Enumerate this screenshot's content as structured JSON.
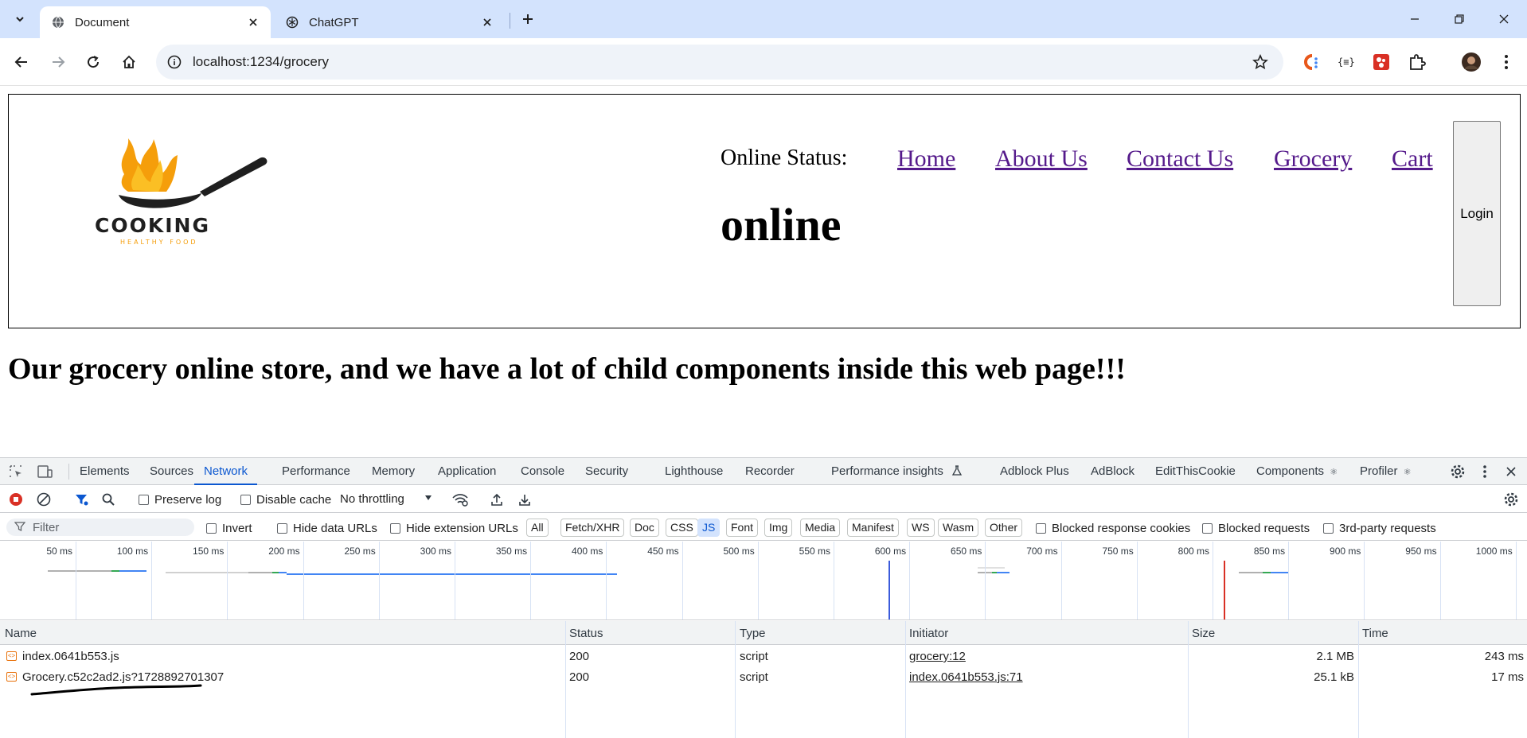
{
  "browser": {
    "tabs": [
      {
        "title": "Document",
        "active": true
      },
      {
        "title": "ChatGPT",
        "active": false
      }
    ],
    "url": "localhost:1234/grocery"
  },
  "page": {
    "online_status_label": "Online Status:",
    "online_status_value": "online",
    "nav": [
      "Home",
      "About Us",
      "Contact Us",
      "Grocery",
      "Cart"
    ],
    "login_label": "Login",
    "logo_text": "COOKING",
    "logo_subtext": "HEALTHY FOOD",
    "heading": "Our grocery online store, and we have a lot of child components inside this web page!!!"
  },
  "devtools": {
    "tabs": [
      "Elements",
      "Sources",
      "Network",
      "Performance",
      "Memory",
      "Application",
      "Console",
      "Security",
      "Lighthouse",
      "Recorder",
      "Performance insights",
      "Adblock Plus",
      "AdBlock",
      "EditThisCookie",
      "Components",
      "Profiler"
    ],
    "active_tab": "Network",
    "controls": {
      "preserve_log": "Preserve log",
      "disable_cache": "Disable cache",
      "throttling": "No throttling"
    },
    "filter": {
      "placeholder": "Filter",
      "invert": "Invert",
      "hide_data_urls": "Hide data URLs",
      "hide_extension_urls": "Hide extension URLs",
      "types": [
        "All",
        "Fetch/XHR",
        "Doc",
        "CSS",
        "JS",
        "Font",
        "Img",
        "Media",
        "Manifest",
        "WS",
        "Wasm",
        "Other"
      ],
      "selected_type": "JS",
      "blocked_response_cookies": "Blocked response cookies",
      "blocked_requests": "Blocked requests",
      "third_party": "3rd-party requests"
    },
    "timeline_ticks": [
      "50 ms",
      "100 ms",
      "150 ms",
      "200 ms",
      "250 ms",
      "300 ms",
      "350 ms",
      "400 ms",
      "450 ms",
      "500 ms",
      "550 ms",
      "600 ms",
      "650 ms",
      "700 ms",
      "750 ms",
      "800 ms",
      "850 ms",
      "900 ms",
      "950 ms",
      "1000 ms"
    ],
    "columns": [
      "Name",
      "Status",
      "Type",
      "Initiator",
      "Size",
      "Time"
    ],
    "rows": [
      {
        "name": "index.0641b553.js",
        "status": "200",
        "type": "script",
        "initiator": "grocery:12",
        "size": "2.1 MB",
        "time": "243 ms"
      },
      {
        "name": "Grocery.c52c2ad2.js?1728892701307",
        "status": "200",
        "type": "script",
        "initiator": "index.0641b553.js:71",
        "size": "25.1 kB",
        "time": "17 ms"
      }
    ]
  }
}
